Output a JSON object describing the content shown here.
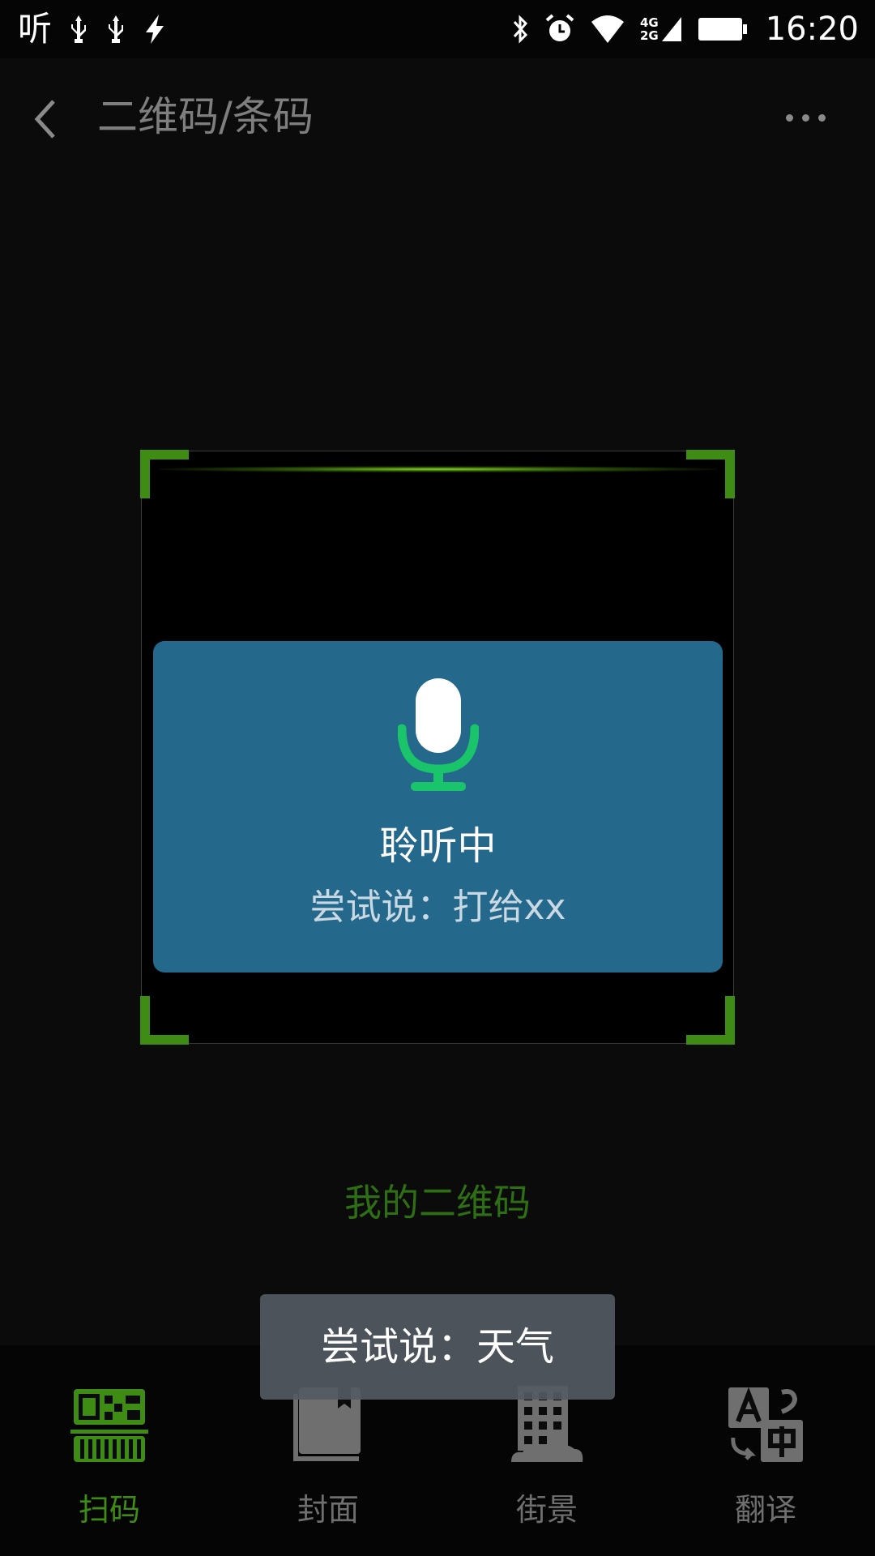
{
  "status_bar": {
    "app_glyph": "听",
    "network_top": "4G",
    "network_bottom": "2G",
    "time": "16:20"
  },
  "header": {
    "title": "二维码/条码"
  },
  "voice_card": {
    "title": "聆听中",
    "hint": "尝试说：打给xx"
  },
  "my_qr_label": "我的二维码",
  "toast": "尝试说：天气",
  "bottom_nav": {
    "items": [
      {
        "label": "扫码",
        "icon": "qr-scan-icon",
        "active": true
      },
      {
        "label": "封面",
        "icon": "book-cover-icon",
        "active": false
      },
      {
        "label": "街景",
        "icon": "street-view-icon",
        "active": false
      },
      {
        "label": "翻译",
        "icon": "translate-icon",
        "active": false
      }
    ]
  },
  "colors": {
    "accent_green": "#3f8c14",
    "voice_card_bg": "#24688b",
    "mic_green": "#19c46a",
    "inactive_icon": "#6f6f6f"
  }
}
